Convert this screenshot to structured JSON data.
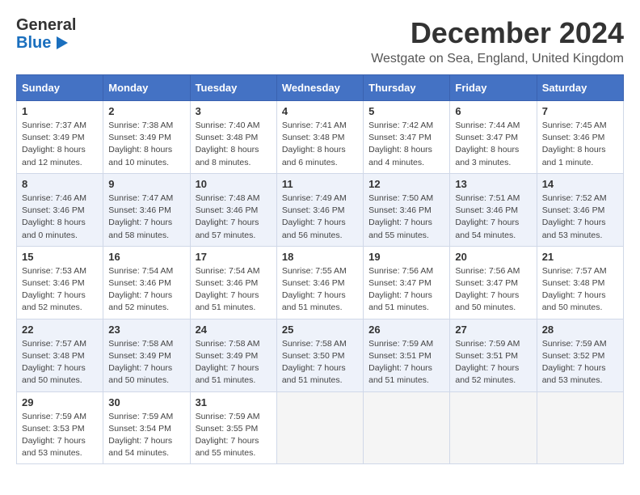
{
  "logo": {
    "general": "General",
    "blue": "Blue"
  },
  "title": "December 2024",
  "subtitle": "Westgate on Sea, England, United Kingdom",
  "days_header": [
    "Sunday",
    "Monday",
    "Tuesday",
    "Wednesday",
    "Thursday",
    "Friday",
    "Saturday"
  ],
  "weeks": [
    [
      {
        "day": "1",
        "sunrise": "Sunrise: 7:37 AM",
        "sunset": "Sunset: 3:49 PM",
        "daylight": "Daylight: 8 hours and 12 minutes."
      },
      {
        "day": "2",
        "sunrise": "Sunrise: 7:38 AM",
        "sunset": "Sunset: 3:49 PM",
        "daylight": "Daylight: 8 hours and 10 minutes."
      },
      {
        "day": "3",
        "sunrise": "Sunrise: 7:40 AM",
        "sunset": "Sunset: 3:48 PM",
        "daylight": "Daylight: 8 hours and 8 minutes."
      },
      {
        "day": "4",
        "sunrise": "Sunrise: 7:41 AM",
        "sunset": "Sunset: 3:48 PM",
        "daylight": "Daylight: 8 hours and 6 minutes."
      },
      {
        "day": "5",
        "sunrise": "Sunrise: 7:42 AM",
        "sunset": "Sunset: 3:47 PM",
        "daylight": "Daylight: 8 hours and 4 minutes."
      },
      {
        "day": "6",
        "sunrise": "Sunrise: 7:44 AM",
        "sunset": "Sunset: 3:47 PM",
        "daylight": "Daylight: 8 hours and 3 minutes."
      },
      {
        "day": "7",
        "sunrise": "Sunrise: 7:45 AM",
        "sunset": "Sunset: 3:46 PM",
        "daylight": "Daylight: 8 hours and 1 minute."
      }
    ],
    [
      {
        "day": "8",
        "sunrise": "Sunrise: 7:46 AM",
        "sunset": "Sunset: 3:46 PM",
        "daylight": "Daylight: 8 hours and 0 minutes."
      },
      {
        "day": "9",
        "sunrise": "Sunrise: 7:47 AM",
        "sunset": "Sunset: 3:46 PM",
        "daylight": "Daylight: 7 hours and 58 minutes."
      },
      {
        "day": "10",
        "sunrise": "Sunrise: 7:48 AM",
        "sunset": "Sunset: 3:46 PM",
        "daylight": "Daylight: 7 hours and 57 minutes."
      },
      {
        "day": "11",
        "sunrise": "Sunrise: 7:49 AM",
        "sunset": "Sunset: 3:46 PM",
        "daylight": "Daylight: 7 hours and 56 minutes."
      },
      {
        "day": "12",
        "sunrise": "Sunrise: 7:50 AM",
        "sunset": "Sunset: 3:46 PM",
        "daylight": "Daylight: 7 hours and 55 minutes."
      },
      {
        "day": "13",
        "sunrise": "Sunrise: 7:51 AM",
        "sunset": "Sunset: 3:46 PM",
        "daylight": "Daylight: 7 hours and 54 minutes."
      },
      {
        "day": "14",
        "sunrise": "Sunrise: 7:52 AM",
        "sunset": "Sunset: 3:46 PM",
        "daylight": "Daylight: 7 hours and 53 minutes."
      }
    ],
    [
      {
        "day": "15",
        "sunrise": "Sunrise: 7:53 AM",
        "sunset": "Sunset: 3:46 PM",
        "daylight": "Daylight: 7 hours and 52 minutes."
      },
      {
        "day": "16",
        "sunrise": "Sunrise: 7:54 AM",
        "sunset": "Sunset: 3:46 PM",
        "daylight": "Daylight: 7 hours and 52 minutes."
      },
      {
        "day": "17",
        "sunrise": "Sunrise: 7:54 AM",
        "sunset": "Sunset: 3:46 PM",
        "daylight": "Daylight: 7 hours and 51 minutes."
      },
      {
        "day": "18",
        "sunrise": "Sunrise: 7:55 AM",
        "sunset": "Sunset: 3:46 PM",
        "daylight": "Daylight: 7 hours and 51 minutes."
      },
      {
        "day": "19",
        "sunrise": "Sunrise: 7:56 AM",
        "sunset": "Sunset: 3:47 PM",
        "daylight": "Daylight: 7 hours and 51 minutes."
      },
      {
        "day": "20",
        "sunrise": "Sunrise: 7:56 AM",
        "sunset": "Sunset: 3:47 PM",
        "daylight": "Daylight: 7 hours and 50 minutes."
      },
      {
        "day": "21",
        "sunrise": "Sunrise: 7:57 AM",
        "sunset": "Sunset: 3:48 PM",
        "daylight": "Daylight: 7 hours and 50 minutes."
      }
    ],
    [
      {
        "day": "22",
        "sunrise": "Sunrise: 7:57 AM",
        "sunset": "Sunset: 3:48 PM",
        "daylight": "Daylight: 7 hours and 50 minutes."
      },
      {
        "day": "23",
        "sunrise": "Sunrise: 7:58 AM",
        "sunset": "Sunset: 3:49 PM",
        "daylight": "Daylight: 7 hours and 50 minutes."
      },
      {
        "day": "24",
        "sunrise": "Sunrise: 7:58 AM",
        "sunset": "Sunset: 3:49 PM",
        "daylight": "Daylight: 7 hours and 51 minutes."
      },
      {
        "day": "25",
        "sunrise": "Sunrise: 7:58 AM",
        "sunset": "Sunset: 3:50 PM",
        "daylight": "Daylight: 7 hours and 51 minutes."
      },
      {
        "day": "26",
        "sunrise": "Sunrise: 7:59 AM",
        "sunset": "Sunset: 3:51 PM",
        "daylight": "Daylight: 7 hours and 51 minutes."
      },
      {
        "day": "27",
        "sunrise": "Sunrise: 7:59 AM",
        "sunset": "Sunset: 3:51 PM",
        "daylight": "Daylight: 7 hours and 52 minutes."
      },
      {
        "day": "28",
        "sunrise": "Sunrise: 7:59 AM",
        "sunset": "Sunset: 3:52 PM",
        "daylight": "Daylight: 7 hours and 53 minutes."
      }
    ],
    [
      {
        "day": "29",
        "sunrise": "Sunrise: 7:59 AM",
        "sunset": "Sunset: 3:53 PM",
        "daylight": "Daylight: 7 hours and 53 minutes."
      },
      {
        "day": "30",
        "sunrise": "Sunrise: 7:59 AM",
        "sunset": "Sunset: 3:54 PM",
        "daylight": "Daylight: 7 hours and 54 minutes."
      },
      {
        "day": "31",
        "sunrise": "Sunrise: 7:59 AM",
        "sunset": "Sunset: 3:55 PM",
        "daylight": "Daylight: 7 hours and 55 minutes."
      },
      null,
      null,
      null,
      null
    ]
  ]
}
